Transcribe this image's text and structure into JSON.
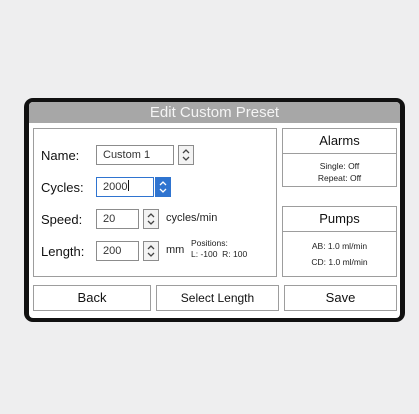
{
  "title": "Edit Custom Preset",
  "form": {
    "name_label": "Name:",
    "name_value": "Custom 1",
    "cycles_label": "Cycles:",
    "cycles_value": "2000",
    "speed_label": "Speed:",
    "speed_value": "20",
    "speed_unit": "cycles/min",
    "length_label": "Length:",
    "length_value": "200",
    "length_unit": "mm",
    "positions_label": "Positions:",
    "positions_values": "L: -100  R: 100"
  },
  "alarms": {
    "title": "Alarms",
    "single": "Single: Off",
    "repeat": "Repeat: Off"
  },
  "pumps": {
    "title": "Pumps",
    "ab": "AB: 1.0 ml/min",
    "cd": "CD: 1.0 ml/min"
  },
  "buttons": {
    "back": "Back",
    "select_length": "Select Length",
    "save": "Save"
  },
  "colors": {
    "accent": "#2f74d0",
    "titlebar": "#a7a7a7",
    "bezel": "#111111"
  }
}
